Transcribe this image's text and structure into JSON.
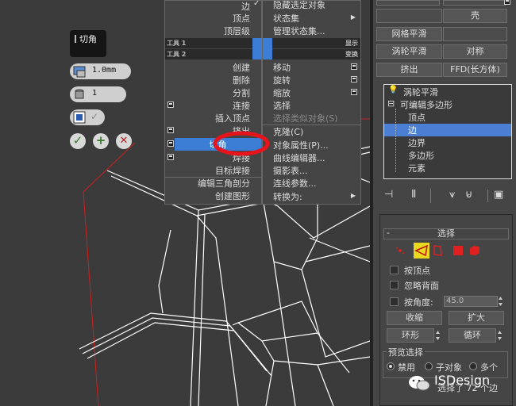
{
  "caddy": {
    "title": "切角",
    "amount": "1.0mm",
    "segments": "1",
    "ok_icon": "checkmark-icon",
    "apply_icon": "plus-icon",
    "cancel_icon": "x-icon"
  },
  "quad_menu": {
    "left": {
      "top_items": [
        "边",
        "顶点",
        "顶层级"
      ],
      "section_tools1": "工具 1",
      "section_tools2": "工具 2",
      "items": [
        "创建",
        "删除",
        "分割",
        "连接",
        "插入顶点",
        "挤出",
        "切角",
        "焊接",
        "目标焊接",
        "编辑三角剖分",
        "创建图形"
      ],
      "highlighted": "切角"
    },
    "right": {
      "items_top": [
        "隐藏选定对象",
        "状态集",
        "管理状态集..."
      ],
      "section_display": "显示",
      "section_transform": "变换",
      "items": [
        "移动",
        "旋转",
        "缩放",
        "选择",
        "选择类似对象(S)",
        "克隆(C)",
        "对象属性(P)...",
        "曲线编辑器...",
        "摄影表...",
        "连线参数...",
        "转换为:"
      ]
    }
  },
  "panel": {
    "shell": "壳",
    "mesh_smooth": "网格平滑",
    "turbo_smooth_btn": "涡轮平滑",
    "symmetry": "对称",
    "extrude": "挤出",
    "ffd_box": "FFD(长方体)",
    "stack": {
      "items": [
        "涡轮平滑",
        "可编辑多边形",
        "顶点",
        "边",
        "边界",
        "多边形",
        "元素"
      ],
      "selected": "边"
    },
    "selection_rollout": {
      "title": "选择",
      "by_vertex": "按顶点",
      "ignore_backfacing": "忽略背面",
      "by_angle": "按角度:",
      "angle_value": "45.0",
      "shrink": "收缩",
      "grow": "扩大",
      "ring": "环形",
      "loop": "循环",
      "preview_label": "预览选择",
      "preview_off": "禁用",
      "preview_subobject": "子对象",
      "preview_multi": "多个",
      "status": "选择了 72 个边"
    }
  },
  "watermark": "ISDesign",
  "colors": {
    "highlight": "#3c7ed6",
    "annotation_circle": "#e8141c",
    "wire": "#ffffff",
    "bbox_red": "#cc2020"
  }
}
